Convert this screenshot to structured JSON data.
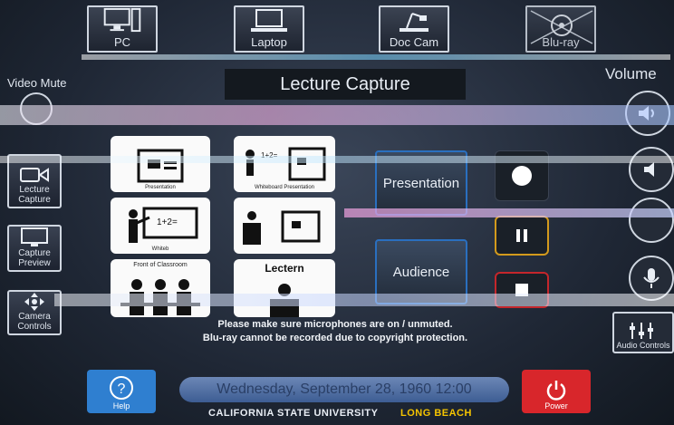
{
  "sources": [
    {
      "label": "PC",
      "icon": "pc-icon"
    },
    {
      "label": "Laptop",
      "icon": "laptop-icon"
    },
    {
      "label": "Doc Cam",
      "icon": "document-camera-icon"
    },
    {
      "label": "Blu-ray",
      "icon": "disc-icon"
    }
  ],
  "page_title": "Lecture Capture",
  "left": {
    "video_mute_label": "Video Mute",
    "buttons": [
      {
        "label": "Lecture Capture"
      },
      {
        "label": "Capture Preview"
      },
      {
        "label": "Camera Controls"
      }
    ]
  },
  "right": {
    "volume_label": "Volume",
    "audio_controls_label": "Audio Controls"
  },
  "layouts": [
    {
      "caption": "Presentation"
    },
    {
      "caption": "Whiteboard Presentation"
    },
    {
      "caption": "Whiteb"
    },
    {
      "caption": ""
    },
    {
      "caption": "Front of Classroom"
    },
    {
      "caption": "Lectern"
    }
  ],
  "modes": [
    {
      "label": "Presentation"
    },
    {
      "label": "Audience"
    }
  ],
  "notice": {
    "line1": "Please make sure microphones are on / unmuted.",
    "line2": "Blu-ray cannot be recorded due to copyright protection."
  },
  "bottom": {
    "help_label": "Help",
    "power_label": "Power",
    "datetime": "Wednesday, September 28, 1960 12:00",
    "footer_left": "CALIFORNIA STATE UNIVERSITY",
    "footer_right": "LONG BEACH"
  },
  "colors": {
    "help_button": "#2f7fd0",
    "power_button": "#d8262b",
    "footer_accent": "#f5c400",
    "mode_border": "#2a6fbf"
  }
}
